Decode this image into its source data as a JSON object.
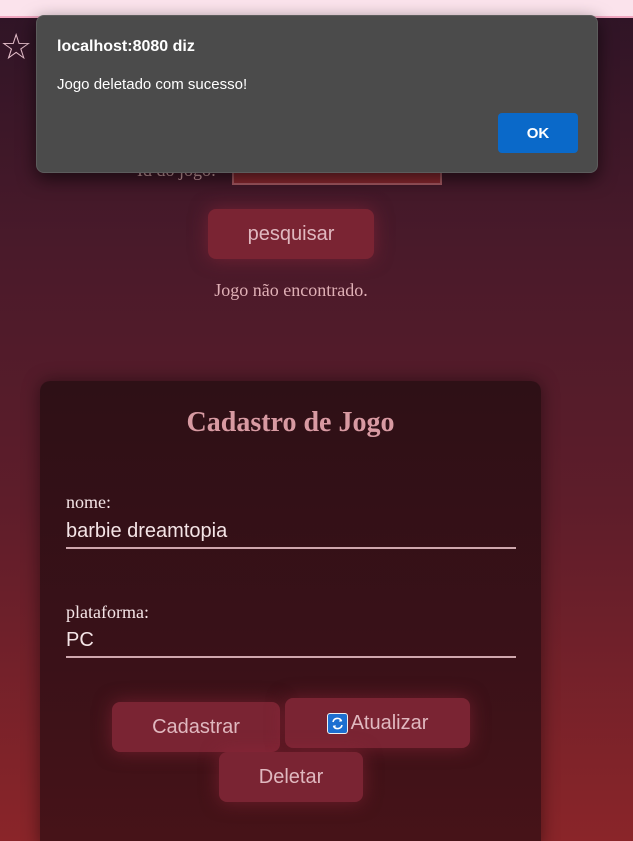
{
  "dialog": {
    "title": "localhost:8080 diz",
    "message": "Jogo deletado com sucesso!",
    "ok_label": "OK"
  },
  "search": {
    "label": "Id do jogo:",
    "value": "",
    "button_label": "pesquisar",
    "status": "Jogo não encontrado."
  },
  "form": {
    "title": "Cadastro de Jogo",
    "fields": [
      {
        "label": "nome:",
        "value": "barbie dreamtopia"
      },
      {
        "label": "plataforma:",
        "value": "PC"
      }
    ],
    "buttons": {
      "cadastrar": "Cadastrar",
      "atualizar": "Atualizar",
      "deletar": "Deletar"
    }
  },
  "icons": {
    "favorite": "star-icon",
    "update": "refresh-icon"
  },
  "colors": {
    "dialog_bg": "#4b4b4b",
    "ok_button": "#0a69c9",
    "button_bg": "#7a2433",
    "card_bg": "#2e1016"
  }
}
